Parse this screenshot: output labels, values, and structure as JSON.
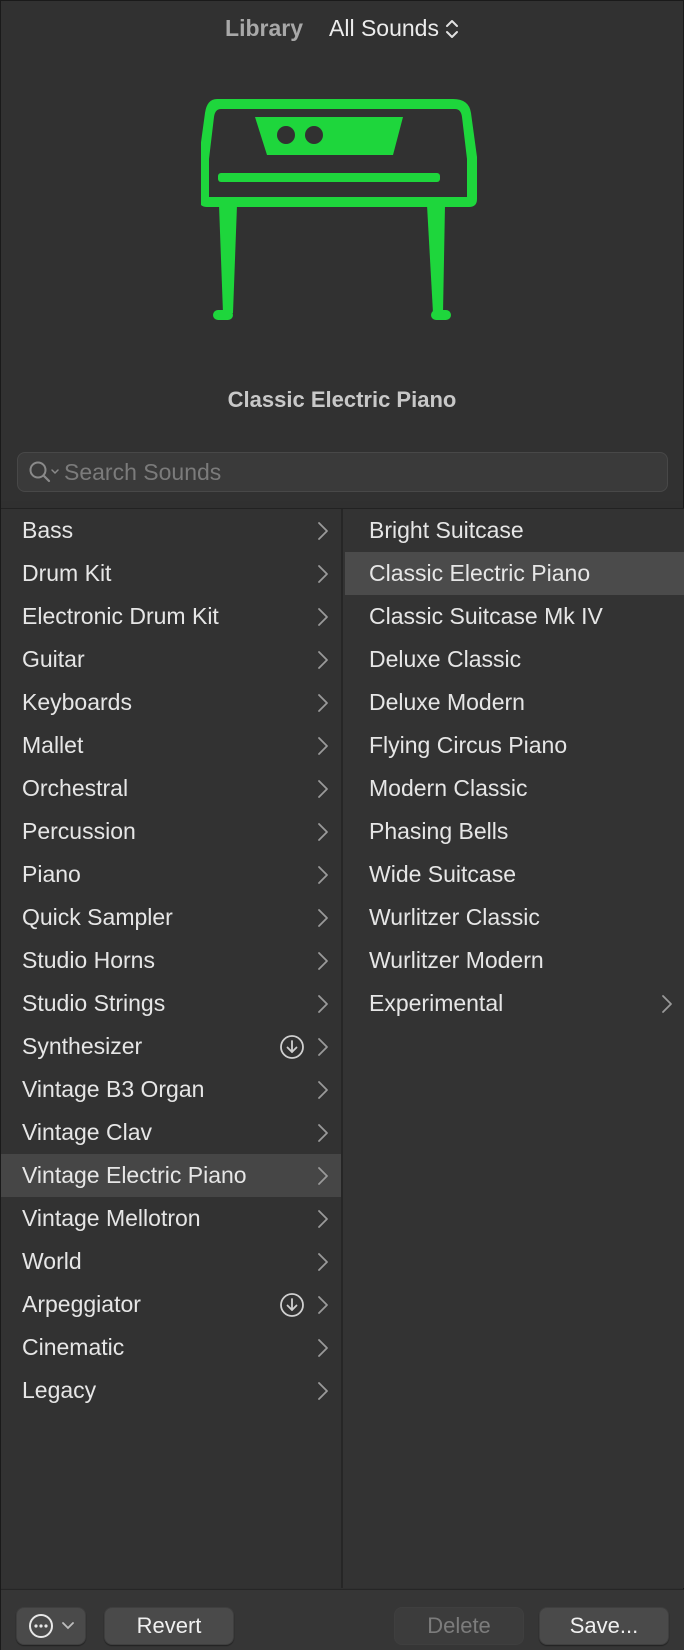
{
  "header": {
    "library_label": "Library",
    "sounds_filter": "All Sounds",
    "instrument_icon": "electric-piano-icon",
    "patch_name": "Classic Electric Piano",
    "accent_color": "#1ed63c"
  },
  "search": {
    "placeholder": "Search Sounds",
    "value": ""
  },
  "categories": [
    {
      "label": "Bass",
      "download": false,
      "selected": false
    },
    {
      "label": "Drum Kit",
      "download": false,
      "selected": false
    },
    {
      "label": "Electronic Drum Kit",
      "download": false,
      "selected": false
    },
    {
      "label": "Guitar",
      "download": false,
      "selected": false
    },
    {
      "label": "Keyboards",
      "download": false,
      "selected": false
    },
    {
      "label": "Mallet",
      "download": false,
      "selected": false
    },
    {
      "label": "Orchestral",
      "download": false,
      "selected": false
    },
    {
      "label": "Percussion",
      "download": false,
      "selected": false
    },
    {
      "label": "Piano",
      "download": false,
      "selected": false
    },
    {
      "label": "Quick Sampler",
      "download": false,
      "selected": false
    },
    {
      "label": "Studio Horns",
      "download": false,
      "selected": false
    },
    {
      "label": "Studio Strings",
      "download": false,
      "selected": false
    },
    {
      "label": "Synthesizer",
      "download": true,
      "selected": false
    },
    {
      "label": "Vintage B3 Organ",
      "download": false,
      "selected": false
    },
    {
      "label": "Vintage Clav",
      "download": false,
      "selected": false
    },
    {
      "label": "Vintage Electric Piano",
      "download": false,
      "selected": true
    },
    {
      "label": "Vintage Mellotron",
      "download": false,
      "selected": false
    },
    {
      "label": "World",
      "download": false,
      "selected": false
    },
    {
      "label": "Arpeggiator",
      "download": true,
      "selected": false
    },
    {
      "label": "Cinematic",
      "download": false,
      "selected": false
    },
    {
      "label": "Legacy",
      "download": false,
      "selected": false
    }
  ],
  "patches": [
    {
      "label": "Bright Suitcase",
      "folder": false,
      "selected": false
    },
    {
      "label": "Classic Electric Piano",
      "folder": false,
      "selected": true
    },
    {
      "label": "Classic Suitcase Mk IV",
      "folder": false,
      "selected": false
    },
    {
      "label": "Deluxe Classic",
      "folder": false,
      "selected": false
    },
    {
      "label": "Deluxe Modern",
      "folder": false,
      "selected": false
    },
    {
      "label": "Flying Circus Piano",
      "folder": false,
      "selected": false
    },
    {
      "label": "Modern Classic",
      "folder": false,
      "selected": false
    },
    {
      "label": "Phasing Bells",
      "folder": false,
      "selected": false
    },
    {
      "label": "Wide Suitcase",
      "folder": false,
      "selected": false
    },
    {
      "label": "Wurlitzer Classic",
      "folder": false,
      "selected": false
    },
    {
      "label": "Wurlitzer Modern",
      "folder": false,
      "selected": false
    },
    {
      "label": "Experimental",
      "folder": true,
      "selected": false
    }
  ],
  "footer": {
    "action_menu_icon": "ellipsis-circle-icon",
    "revert_label": "Revert",
    "delete_label": "Delete",
    "save_label": "Save..."
  }
}
